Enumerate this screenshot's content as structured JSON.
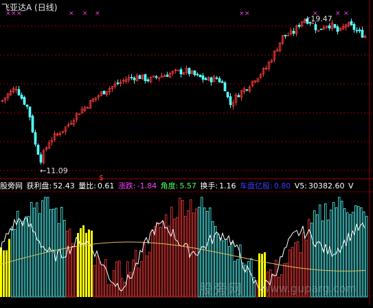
{
  "header": {
    "title": "飞亚达A (日线)"
  },
  "price_panel": {
    "high_label": "19.47",
    "low_label": "11.09",
    "signal_label": "$"
  },
  "indicator_bar": {
    "source": "股旁网",
    "profit_label": "获利盘:",
    "profit_value": "52.43",
    "ratio_label": "量比:",
    "ratio_value": "0.61",
    "change_label": "涨跌:",
    "change_value": "-1.84",
    "angle_label": "角度:",
    "angle_value": "5.57",
    "turnover_label": "换手:",
    "turnover_value": "1.16",
    "float_label": "车盘亿股:",
    "float_value": "0.80",
    "v5_label": "V5:",
    "v5_value": "30382.60",
    "v_label": "V"
  },
  "watermark": {
    "left": "股旁网",
    "right": "www.guparg.com"
  },
  "colors": {
    "up": "#ff3c3c",
    "down": "#54ffff",
    "marker": "#ff3cff",
    "yellow": "#ffff00",
    "white_line": "#ffffff",
    "ma_line": "#e0c060",
    "grid": "#a00000"
  },
  "chart_data": {
    "type": "candlestick",
    "title": "飞亚达A (日线)",
    "price_range": [
      11.09,
      19.47
    ],
    "annotations": [
      "19.47",
      "11.09"
    ],
    "indicators": [
      "获利盘 52.43",
      "量比 0.61",
      "涨跌 -1.84",
      "角度 5.57",
      "换手 1.16",
      "车盘亿股 0.80",
      "V5 30382.60"
    ]
  }
}
